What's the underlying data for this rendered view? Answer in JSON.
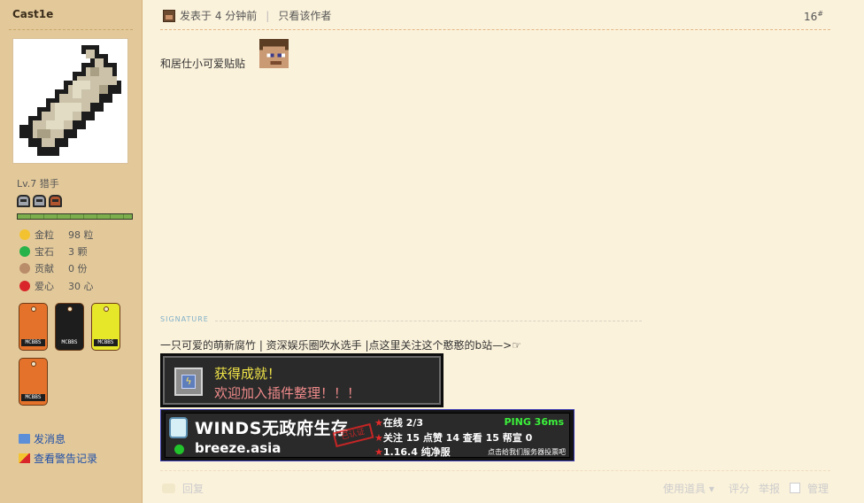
{
  "user": {
    "name": "Cast1e",
    "level": "Lv.7 猎手",
    "stats": [
      {
        "label": "金粒",
        "value": "98 粒",
        "icon": "gold-nugget-icon",
        "color": "#f2c230"
      },
      {
        "label": "宝石",
        "value": "3 颗",
        "icon": "emerald-icon",
        "color": "#27b24a"
      },
      {
        "label": "贡献",
        "value": "0 份",
        "icon": "cookie-icon",
        "color": "#b98c6a"
      },
      {
        "label": "爱心",
        "value": "30 心",
        "icon": "apple-icon",
        "color": "#d8262a"
      }
    ],
    "badges": [
      {
        "tag": "MCBBS",
        "icon": "badge-orange-icon",
        "color": "#e5722a"
      },
      {
        "tag": "MCBBS",
        "icon": "badge-steve-icon",
        "color": "#1d1d1d"
      },
      {
        "tag": "MCBBS",
        "icon": "badge-pickaxe-icon",
        "color": "#e7e72a"
      },
      {
        "tag": "MCBBS",
        "icon": "badge-wheat-icon",
        "color": "#e5722a"
      }
    ],
    "links": {
      "message": "发消息",
      "warnings": "查看警告记录"
    }
  },
  "post": {
    "meta": {
      "posted": "发表于 4 分钟前",
      "separator": "|",
      "only_author": "只看该作者"
    },
    "floor": "16",
    "floor_mark": "#",
    "text": "和居仕小可爱贴贴"
  },
  "signature": {
    "label": "SIGNATURE",
    "text": "一只可爱的萌新腐竹 | 资深娱乐圈吹水选手 |点这里关注这个憨憨的b站—>☞",
    "achievement": {
      "title": "获得成就！",
      "desc": "欢迎加入插件整理！！！"
    },
    "server": {
      "name": "WINDS无政府生存",
      "host": "breeze.asia",
      "ping": "PING 36ms",
      "online": "在线 2/3",
      "follow": "关注 15 点赞 14 查看 15 帮宣 0",
      "version": "1.16.4 纯净服",
      "vote": "点击给我们服务器投票吧",
      "star": "★",
      "stamp": "已认证"
    }
  },
  "footer": {
    "reply": "回复",
    "tools": "使用道具 ▾",
    "rate": "评分",
    "report": "举报",
    "manage": "管理"
  }
}
